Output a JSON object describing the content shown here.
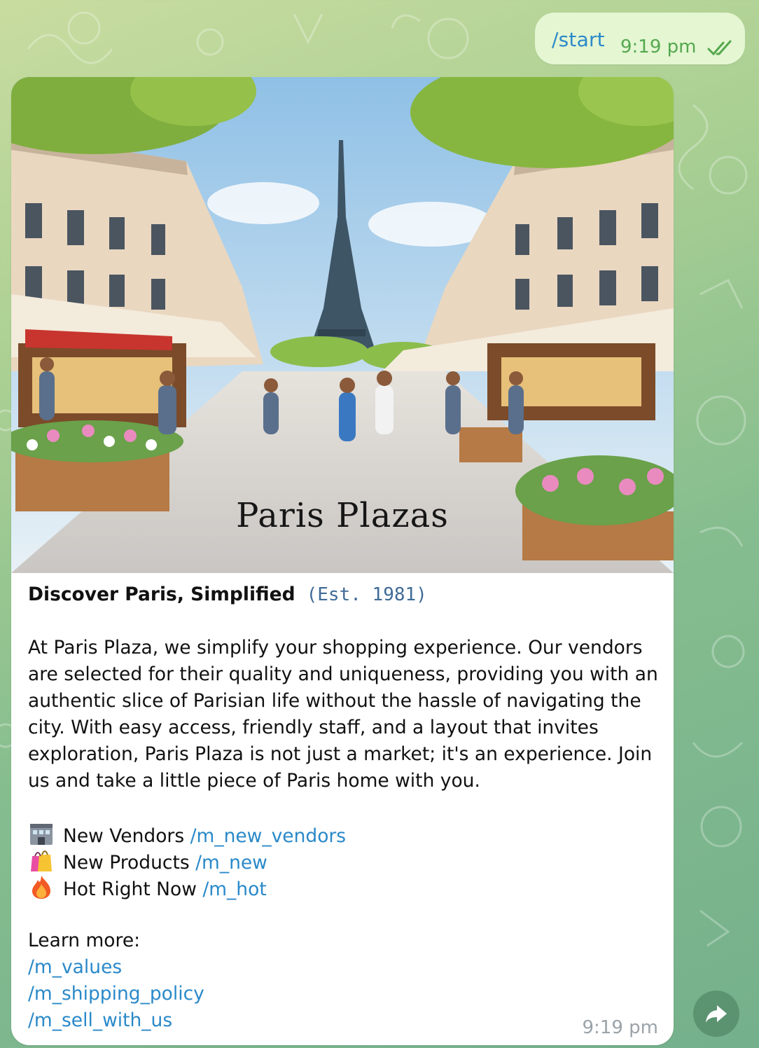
{
  "colors": {
    "link": "#2a89c9",
    "outgoing_bubble": "#e4f6d2",
    "outgoing_time": "#55a84f",
    "code": "#3f6b96",
    "timestamp_gray": "#9aa3a9"
  },
  "outgoing_message": {
    "text": "/start",
    "time": "9:19 pm",
    "status_icon": "double-check-icon"
  },
  "incoming_message": {
    "photo": {
      "description_icon": "paris-plazas-illustration",
      "caption": "Paris Plazas"
    },
    "headline": {
      "title": "Discover Paris, Simplified",
      "code": "(Est. 1981)"
    },
    "paragraph_lines": [
      "At Paris Plaza, we simplify your shopping experience. Our vendors",
      "are selected for their quality and uniqueness, providing you with an",
      "authentic slice of Parisian life without the hassle of navigating the",
      "city. With easy access, friendly staff, and a layout that invites",
      "exploration, Paris Plaza is not just a market; it's an experience. Join",
      "us and take a little piece of Paris home with you."
    ],
    "menu": [
      {
        "icon": "storefront-emoji-icon",
        "label": "New Vendors",
        "command": "/m_new_vendors"
      },
      {
        "icon": "shopping-bags-emoji-icon",
        "label": "New Products",
        "command": "/m_new"
      },
      {
        "icon": "fire-emoji-icon",
        "label": "Hot Right Now",
        "command": "/m_hot"
      }
    ],
    "learn_more_label": "Learn more:",
    "links": [
      "/m_values",
      "/m_shipping_policy",
      "/m_sell_with_us"
    ],
    "time": "9:19 pm"
  },
  "share_button": {
    "icon": "forward-arrow-icon"
  }
}
